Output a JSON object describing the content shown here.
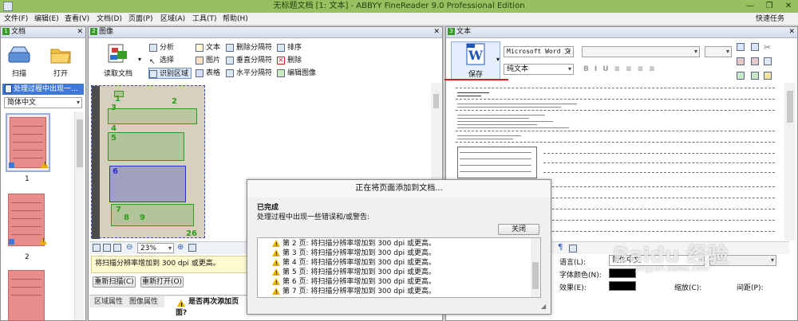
{
  "window": {
    "title": "无标题文档 [1: 文本] - ABBYY FineReader 9.0 Professional Edition",
    "help_task": "快速任务(Q)"
  },
  "menu": [
    "文件(F)",
    "编辑(E)",
    "查看(V)",
    "文档(D)",
    "页面(P)",
    "区域(A)",
    "工具(T)",
    "帮助(H)"
  ],
  "doc_panel": {
    "title": "文档",
    "num": "1",
    "scan_label": "扫描",
    "open_label": "打开",
    "processing_text": "处理过程中出现一...",
    "language_value": "简体中文",
    "page_numbers": [
      "1",
      "2"
    ]
  },
  "image_panel": {
    "title": "图像",
    "num": "2",
    "read_label": "读取文档",
    "tools": {
      "analyze": "分析",
      "select": "选择",
      "recog_region": "识别区域",
      "text": "文本",
      "picture": "图片",
      "table": "表格",
      "del_sep": "删除分隔符",
      "vert_sep": "垂直分隔符",
      "horiz_sep": "水平分隔符",
      "order": "排序",
      "delete": "删除",
      "edit_image": "编辑图像"
    },
    "zoom": "23%",
    "warning": "将扫描分辨率增加到 300 dpi 或更高。",
    "rescan_label": "重新扫描(C)",
    "reopen_label": "重新打开(O)",
    "tabs": [
      "区域属性",
      "图像属性",
      "是否再次添加页面?"
    ],
    "zone_numbers": [
      "1",
      "2",
      "3",
      "4",
      "5",
      "6",
      "7",
      "8",
      "9",
      "26"
    ]
  },
  "text_panel": {
    "title": "文本",
    "num": "3",
    "save_label": "保存",
    "format_value": "Microsoft Word 文",
    "plain_text": "纯文本",
    "language_label": "语言(L):",
    "language_value": "简体中文",
    "font_color_label": "字体颜色(N):",
    "effect_label": "效果(E):",
    "scale_label": "缩放(C):",
    "spacing_label": "间距(P):"
  },
  "dialog": {
    "title": "正在将页面添加到文档...",
    "done_label": "已完成",
    "message": "处理过程中出现一些错误和/或警告:",
    "close_label": "关闭",
    "rows": [
      "第 2 页:  将扫描分辨率增加到 300 dpi 或更高。",
      "第 3 页:  将扫描分辨率增加到 300 dpi 或更高。",
      "第 4 页:  将扫描分辨率增加到 300 dpi 或更高。",
      "第 5 页:  将扫描分辨率增加到 300 dpi 或更高。",
      "第 6 页:  将扫描分辨率增加到 300 dpi 或更高。",
      "第 7 页:  将扫描分辨率增加到 300 dpi 或更高。"
    ]
  },
  "watermark": {
    "text": "Baidu 经验",
    "url": "jingyan.baidu.com"
  },
  "colors": {
    "titlebar": "#97c160",
    "zone_green": "#2e9b1d",
    "zone_blue": "#2633c4",
    "thumb": "#e98c8c",
    "underline_red": "#d81e1e"
  }
}
